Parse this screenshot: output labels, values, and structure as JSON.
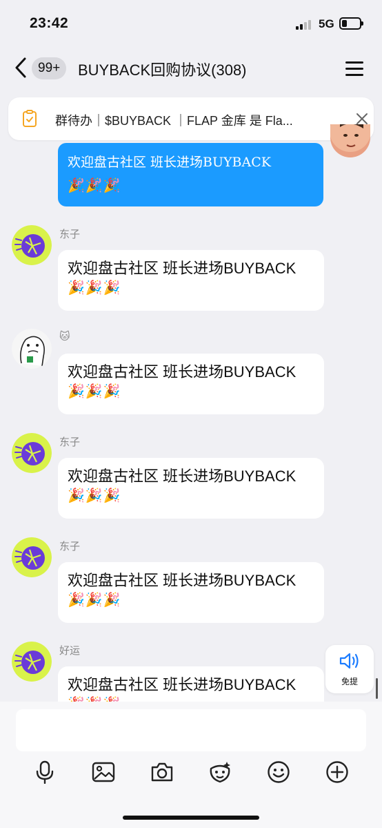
{
  "status_bar": {
    "time": "23:42",
    "network": "5G",
    "battery_percent": 30
  },
  "nav": {
    "unread_badge": "99+",
    "title": "BUYBACK回购协议(308)",
    "back_icon": "chevron-left-icon",
    "menu_icon": "menu-icon"
  },
  "todo": {
    "text": "群待办｜$BUYBACK ｜FLAP 金库 是 Fla...",
    "icon": "todo-clipboard-icon",
    "close_icon": "close-icon"
  },
  "own_message": {
    "line1": "欢迎盘古社区 班长进场BUYBACK",
    "emoji": "🎉🎉🎉"
  },
  "messages": [
    {
      "sender": "东子",
      "line1": "欢迎盘古社区 班长进场BUYBACK",
      "emoji": "🎉🎉🎉"
    },
    {
      "sender": "🐱",
      "line1": "欢迎盘古社区 班长进场BUYBACK",
      "emoji": "🎉🎉🎉"
    },
    {
      "sender": "东子",
      "line1": "欢迎盘古社区 班长进场BUYBACK",
      "emoji": "🎉🎉🎉"
    },
    {
      "sender": "东子",
      "line1": "欢迎盘古社区 班长进场BUYBACK",
      "emoji": "🎉🎉🎉"
    },
    {
      "sender": "好运",
      "line1": "欢迎盘古社区 班长进场BUYBACK",
      "emoji": "🎉🎉🎉"
    }
  ],
  "voice_float": {
    "label": "免提",
    "icon": "speaker-icon"
  },
  "composer": {
    "input_value": "",
    "tools": [
      "microphone-icon",
      "image-icon",
      "camera-icon",
      "sticker-icon",
      "emoji-icon",
      "plus-icon"
    ]
  },
  "colors": {
    "own_bubble": "#1b9bff",
    "background": "#f0f0f4",
    "accent": "#1b7cff"
  }
}
